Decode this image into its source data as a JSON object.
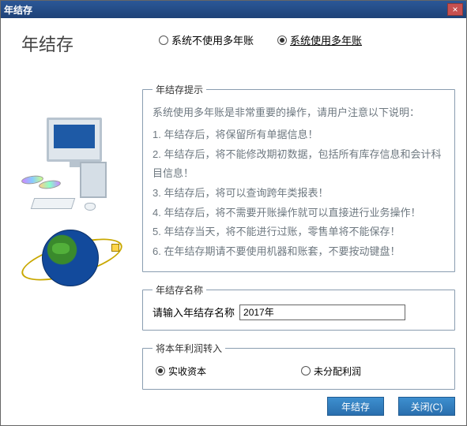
{
  "window": {
    "title": "年结存"
  },
  "page_title": "年结存",
  "mode_radios": {
    "no_multi": "系统不使用多年账",
    "multi": "系统使用多年账",
    "selected": "multi"
  },
  "tips": {
    "legend": "年结存提示",
    "intro": "系统使用多年账是非常重要的操作，请用户注意以下说明：",
    "items": [
      "1. 年结存后，将保留所有单据信息！",
      "2. 年结存后，将不能修改期初数据，包括所有库存信息和会计科目信息！",
      "3. 年结存后，将可以查询跨年类报表！",
      "4. 年结存后，将不需要开账操作就可以直接进行业务操作！",
      "5. 年结存当天，将不能进行过账，零售单将不能保存！",
      "6. 在年结存期请不要使用机器和账套，不要按动键盘！"
    ]
  },
  "name_field": {
    "legend": "年结存名称",
    "label": "请输入年结存名称",
    "value": "2017年"
  },
  "profit": {
    "legend": "将本年利润转入",
    "paid_in_capital": "实收资本",
    "undistributed": "未分配利润",
    "selected": "paid_in_capital"
  },
  "buttons": {
    "ok": "年结存",
    "close": "关闭(C)"
  }
}
